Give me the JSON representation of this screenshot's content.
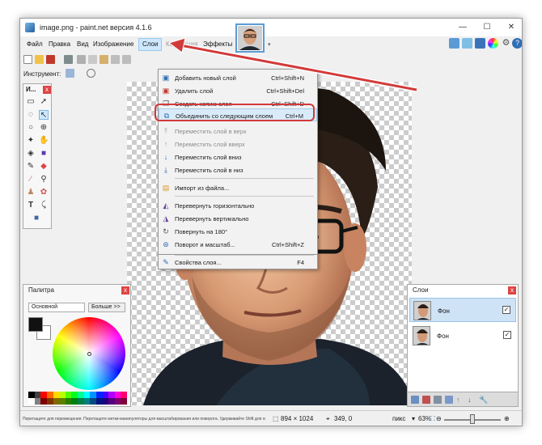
{
  "window": {
    "title": "image.png - paint.net версия 4.1.6",
    "minimize_glyph": "—",
    "maximize_glyph": "☐",
    "close_glyph": "✕"
  },
  "menubar": {
    "items": [
      "Файл",
      "Правка",
      "Вид",
      "Изображение",
      "Слои",
      "Коррекция",
      "Эффекты"
    ],
    "active": "Слои"
  },
  "toolbar": {
    "tool_label": "Инструмент:"
  },
  "tools_panel": {
    "title": "И...",
    "close_glyph": "x",
    "text_tool_glyph": "T"
  },
  "palette": {
    "title": "Палитра",
    "mode": "Основной",
    "more_button": "Больше >>",
    "close_glyph": "x"
  },
  "layers_panel": {
    "title": "Слои",
    "close_glyph": "x",
    "layers": [
      {
        "name": "Фон",
        "checked": true,
        "selected": true
      },
      {
        "name": "Фон",
        "checked": true,
        "selected": false
      }
    ]
  },
  "layer_menu": {
    "items": [
      {
        "label": "Добавить новый слой",
        "shortcut": "Ctrl+Shift+N",
        "icon": "add-layer-icon",
        "enabled": true
      },
      {
        "label": "Удалить слой",
        "shortcut": "Ctrl+Shift+Del",
        "icon": "delete-layer-icon",
        "enabled": true
      },
      {
        "label": "Создать копию слоя",
        "shortcut": "Ctrl+Shift+D",
        "icon": "duplicate-layer-icon",
        "enabled": true
      },
      {
        "label": "Объединить со следующим слоем",
        "shortcut": "Ctrl+M",
        "icon": "merge-layer-icon",
        "enabled": true,
        "highlighted": true
      },
      {
        "label": "Переместить слой в верх",
        "shortcut": "",
        "icon": "move-top-icon",
        "enabled": false
      },
      {
        "label": "Переместить слой вверх",
        "shortcut": "",
        "icon": "move-up-icon",
        "enabled": false
      },
      {
        "label": "Переместить слой вниз",
        "shortcut": "",
        "icon": "move-down-icon",
        "enabled": true
      },
      {
        "label": "Переместить слой в низ",
        "shortcut": "",
        "icon": "move-bottom-icon",
        "enabled": true
      },
      {
        "label": "Импорт из файла...",
        "shortcut": "",
        "icon": "import-file-icon",
        "enabled": true
      },
      {
        "label": "Перевернуть горизонтально",
        "shortcut": "",
        "icon": "flip-horizontal-icon",
        "enabled": true
      },
      {
        "label": "Перевернуть вертикально",
        "shortcut": "",
        "icon": "flip-vertical-icon",
        "enabled": true
      },
      {
        "label": "Повернуть на 180°",
        "shortcut": "",
        "icon": "rotate-180-icon",
        "enabled": true
      },
      {
        "label": "Поворот и масштаб...",
        "shortcut": "Ctrl+Shift+Z",
        "icon": "rotate-zoom-icon",
        "enabled": true
      },
      {
        "label": "Свойства слоя...",
        "shortcut": "F4",
        "icon": "layer-properties-icon",
        "enabled": true
      }
    ]
  },
  "statusbar": {
    "hint": "Перетащите для перемещения. Перетащите метки-манипуляторы для масштабирования или поворота. Удерживайте Shift для ограничен...",
    "image_size": "894 × 1024",
    "cursor_pos": "349, 0",
    "units": "пикс",
    "zoom": "63%"
  },
  "colors": {
    "accent": "#d23a3a",
    "menu_highlight": "#d9ebf9",
    "tab_border": "#5b9bd5"
  }
}
